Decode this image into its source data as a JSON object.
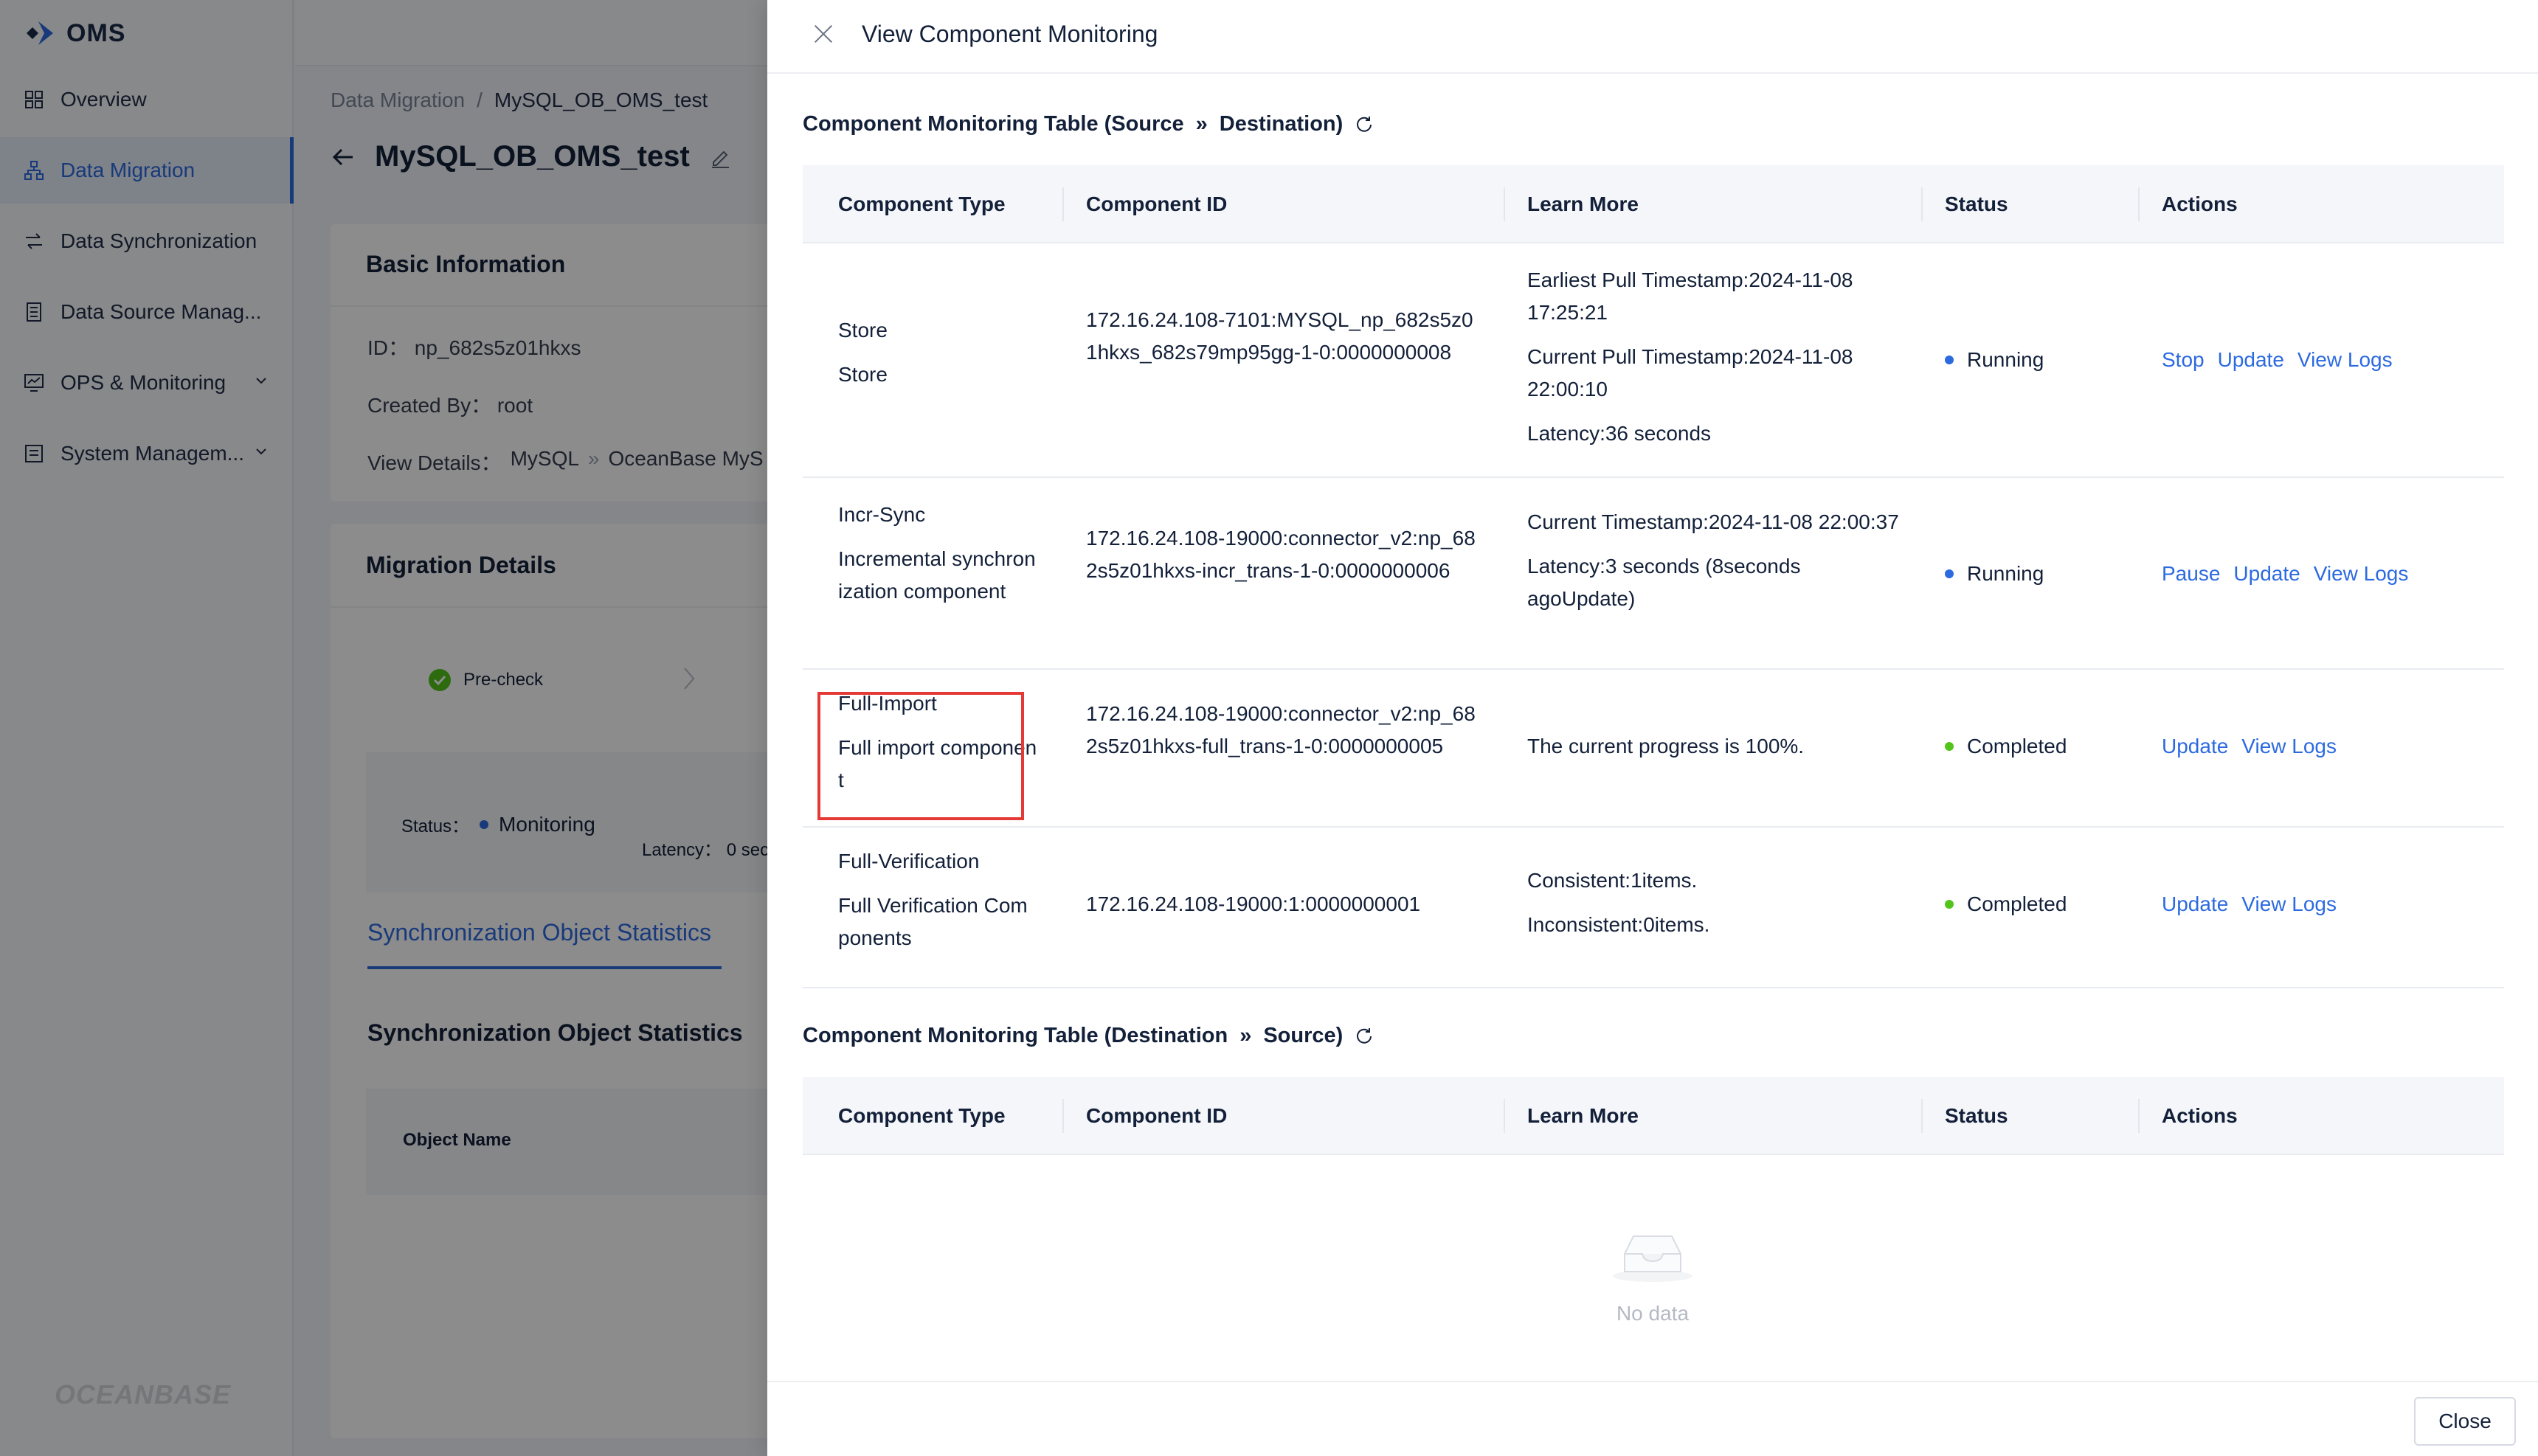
{
  "app": {
    "logo": "OMS",
    "brand_bottom": "OCEANBASE",
    "sidebar": {
      "items": [
        {
          "label": "Overview",
          "icon": "grid-icon"
        },
        {
          "label": "Data Migration",
          "icon": "migration-icon"
        },
        {
          "label": "Data Synchronization",
          "icon": "sync-icon"
        },
        {
          "label": "Data Source Manag...",
          "icon": "datasource-icon"
        },
        {
          "label": "OPS & Monitoring",
          "icon": "monitor-icon"
        },
        {
          "label": "System Managem...",
          "icon": "system-icon"
        }
      ]
    },
    "breadcrumb": {
      "parent": "Data Migration",
      "separator": "/",
      "current": "MySQL_OB_OMS_test"
    },
    "page_title": "MySQL_OB_OMS_test",
    "basic_info": {
      "title": "Basic Information",
      "id": "ID： np_682s5z01hkxs",
      "created_by": "Created By： root",
      "view_details_label": "View Details：",
      "source": "MySQL",
      "target": "OceanBase MyS"
    },
    "migration_details": {
      "title": "Migration Details",
      "precheck": "Pre-check",
      "status_label": "Status：",
      "status_value": "Monitoring",
      "latency_label": "Latency： 0 sec"
    },
    "sync_tab": "Synchronization Object Statistics",
    "sync_title": "Synchronization Object Statistics",
    "object_name_header": "Object Name"
  },
  "drawer": {
    "title": "View Component Monitoring",
    "section1": {
      "title_prefix": "Component Monitoring Table (Source",
      "title_suffix": "Destination)"
    },
    "section2": {
      "title_prefix": "Component Monitoring Table (Destination",
      "title_suffix": "Source)"
    },
    "columns": [
      "Component Type",
      "Component ID",
      "Learn More",
      "Status",
      "Actions"
    ],
    "rows": [
      {
        "type": [
          "Store",
          "Store"
        ],
        "id": "172.16.24.108-7101:MYSQL_np_682s5z01hkxs_682s79mp95gg-1-0:0000000008",
        "learn_more": [
          "Earliest Pull Timestamp:2024-11-08 17:25:21",
          "Current Pull Timestamp:2024-11-08 22:00:10",
          "Latency:36 seconds"
        ],
        "status": "Running",
        "actions": [
          "Stop",
          "Update",
          "View Logs"
        ]
      },
      {
        "type": [
          "Incr-Sync",
          "Incremental synchronization component"
        ],
        "id": "172.16.24.108-19000:connector_v2:np_682s5z01hkxs-incr_trans-1-0:0000000006",
        "learn_more": [
          "Current Timestamp:2024-11-08 22:00:37",
          "Latency:3 seconds (8seconds agoUpdate)"
        ],
        "status": "Running",
        "actions": [
          "Pause",
          "Update",
          "View Logs"
        ]
      },
      {
        "type": [
          "Full-Import",
          "Full import component"
        ],
        "id": "172.16.24.108-19000:connector_v2:np_682s5z01hkxs-full_trans-1-0:0000000005",
        "learn_more": [
          "The current progress is 100%."
        ],
        "status": "Completed",
        "actions": [
          "Update",
          "View Logs"
        ]
      },
      {
        "type": [
          "Full-Verification",
          "Full Verification Components"
        ],
        "id": "172.16.24.108-19000:1:0000000001",
        "learn_more": [
          "Consistent:1items.",
          "Inconsistent:0items."
        ],
        "status": "Completed",
        "actions": [
          "Update",
          "View Logs"
        ]
      }
    ],
    "empty_text": "No data",
    "close_button": "Close"
  },
  "colors": {
    "accent": "#2c6ae0",
    "running": "#2c6ae0",
    "completed": "#52c41a",
    "highlight": "#e53935"
  }
}
